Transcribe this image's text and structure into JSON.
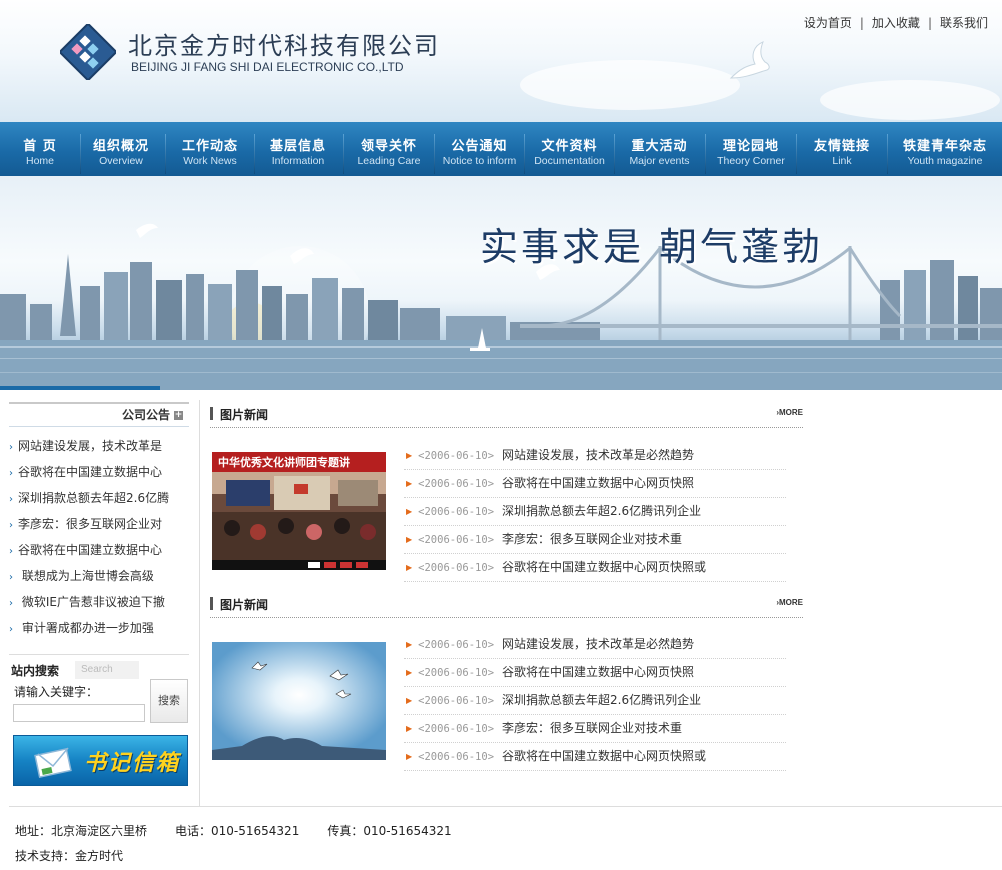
{
  "header": {
    "company_cn": "北京金方时代科技有限公司",
    "company_en": "BEIJING JI FANG SHI DAI  ELECTRONIC CO.,LTD",
    "top_links": [
      "设为首页",
      "加入收藏",
      "联系我们"
    ]
  },
  "nav": [
    {
      "cn": "首  页",
      "en": "Home"
    },
    {
      "cn": "组织概况",
      "en": "Overview"
    },
    {
      "cn": "工作动态",
      "en": "Work News"
    },
    {
      "cn": "基层信息",
      "en": "Information"
    },
    {
      "cn": "领导关怀",
      "en": "Leading Care"
    },
    {
      "cn": "公告通知",
      "en": "Notice to inform"
    },
    {
      "cn": "文件资料",
      "en": "Documentation"
    },
    {
      "cn": "重大活动",
      "en": "Major events"
    },
    {
      "cn": "理论园地",
      "en": "Theory Corner"
    },
    {
      "cn": "友情链接",
      "en": "Link"
    },
    {
      "cn": "铁建青年杂志",
      "en": "Youth magazine"
    }
  ],
  "banner": {
    "slogan": "实事求是 朝气蓬勃",
    "photo1_caption": "中华优秀文化讲师团专题讲"
  },
  "notice": {
    "title": "公司公告",
    "items": [
      "网站建设发展，技术改革是",
      "谷歌将在中国建立数据中心",
      "深圳捐款总额去年超2.6亿腾",
      "李彦宏：很多互联网企业对",
      "谷歌将在中国建立数据中心",
      " 联想成为上海世博会高级",
      " 微软IE广告惹非议被迫下撤",
      " 审计署成都办进一步加强"
    ]
  },
  "search": {
    "title": "站内搜索",
    "tab": "Search",
    "label": "请输入关键字：",
    "value": "",
    "button": "搜索"
  },
  "mailbox": {
    "label": "书记信箱"
  },
  "news_sections": [
    {
      "title": "图片新闻",
      "more": "MORE",
      "items": [
        {
          "date": "<2006-06-10>",
          "text": "网站建设发展，技术改革是必然趋势"
        },
        {
          "date": "<2006-06-10>",
          "text": "谷歌将在中国建立数据中心网页快照"
        },
        {
          "date": "<2006-06-10>",
          "text": "深圳捐款总额去年超2.6亿腾讯列企业"
        },
        {
          "date": "<2006-06-10>",
          "text": "李彦宏：很多互联网企业对技术重"
        },
        {
          "date": "<2006-06-10>",
          "text": "谷歌将在中国建立数据中心网页快照或"
        }
      ]
    },
    {
      "title": "图片新闻",
      "more": "MORE",
      "items": [
        {
          "date": "<2006-06-10>",
          "text": "网站建设发展，技术改革是必然趋势"
        },
        {
          "date": "<2006-06-10>",
          "text": "谷歌将在中国建立数据中心网页快照"
        },
        {
          "date": "<2006-06-10>",
          "text": "深圳捐款总额去年超2.6亿腾讯列企业"
        },
        {
          "date": "<2006-06-10>",
          "text": "李彦宏：很多互联网企业对技术重"
        },
        {
          "date": "<2006-06-10>",
          "text": "谷歌将在中国建立数据中心网页快照或"
        }
      ]
    }
  ],
  "footer": {
    "address": "地址：北京海淀区六里桥",
    "phone": "电话：010-51654321",
    "fax": "传真：010-51654321",
    "support": "技术支持：金方时代"
  },
  "colors": {
    "nav_blue": "#1a6aa7",
    "title_navy": "#1d3c66",
    "bullet_orange": "#e46b1b",
    "mailbox_yellow": "#ffd21e"
  }
}
